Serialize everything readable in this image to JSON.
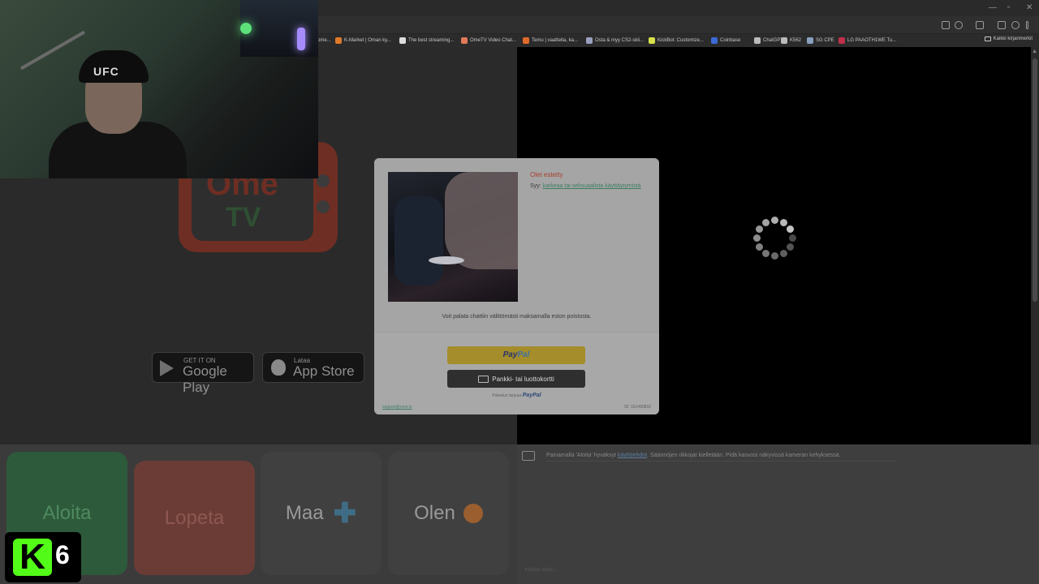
{
  "browser": {
    "window_controls": [
      "—",
      "▫",
      "✕"
    ],
    "bookmarks": [
      {
        "label": "...ome...",
        "icon": "bookmark-icon",
        "color": "#888888"
      },
      {
        "label": "K-Market | Oman ky...",
        "icon": "kmarket-icon",
        "color": "#e07a2a"
      },
      {
        "label": "The best streaming...",
        "icon": "diamond-icon",
        "color": "#dddddd"
      },
      {
        "label": "OmeTV Video Chat...",
        "icon": "ometv-icon",
        "color": "#e07a5a"
      },
      {
        "label": "Temu | vaatteita, ka...",
        "icon": "temu-icon",
        "color": "#e06a2a"
      },
      {
        "label": "Osta & myy CS2-skii...",
        "icon": "cs-icon",
        "color": "#9aa0c0"
      },
      {
        "label": "KickBot: Customize...",
        "icon": "kickbot-icon",
        "color": "#d6e04a"
      },
      {
        "label": "Coinbase",
        "icon": "coinbase-icon",
        "color": "#3a6ad6"
      },
      {
        "label": "ChatGPT",
        "icon": "chatgpt-icon",
        "color": "#bbbbbb"
      },
      {
        "label": "K562",
        "icon": "k562-icon",
        "color": "#bbbbbb"
      },
      {
        "label": "SG CPE",
        "icon": "sgcpe-icon",
        "color": "#8aa0c0"
      },
      {
        "label": "LG PAAOTH1WE Tu...",
        "icon": "lg-icon",
        "color": "#c0304a"
      }
    ],
    "bookmarks_folder": "Kaikki kirjanmerkit"
  },
  "page": {
    "logo_text_top": "Ome",
    "logo_text_bottom": "TV",
    "google_play": {
      "small": "GET IT ON",
      "big": "Google Play"
    },
    "app_store": {
      "small": "Lataa",
      "big": "App Store"
    }
  },
  "modal": {
    "title": "Olet estetty",
    "reason_label": "Syy:",
    "reason_text": "karkeaa tai seksuaalista käyttäytymistä",
    "notice": "Voit palata chattiin välittömästi maksamalla eston poistosta.",
    "paypal_pay": "Pay",
    "paypal_pal": "Pal",
    "card_button": "Pankki- tai luottokortti",
    "powered_by": "Palvelun tarjoaa",
    "powered_brand": "PayPal",
    "support_link": "support@ome.tv",
    "ban_id": "ID: 161490832"
  },
  "controls": {
    "start": "Aloita",
    "stop": "Lopeta",
    "country": "Maa",
    "gender": "Olen"
  },
  "chat": {
    "message_prefix": "Painamalla 'Aloita' hyväksyt",
    "message_link": "käyttöehdot",
    "message_suffix": ". Säännöjen rikkojat kielletään. Pidä kasvosi näkyvissä kameran kehyksessä.",
    "footer": "Kirjoita viesti..."
  },
  "overlay": {
    "badge_letter": "K",
    "badge_number": "6",
    "cap_logo": "UFC"
  }
}
